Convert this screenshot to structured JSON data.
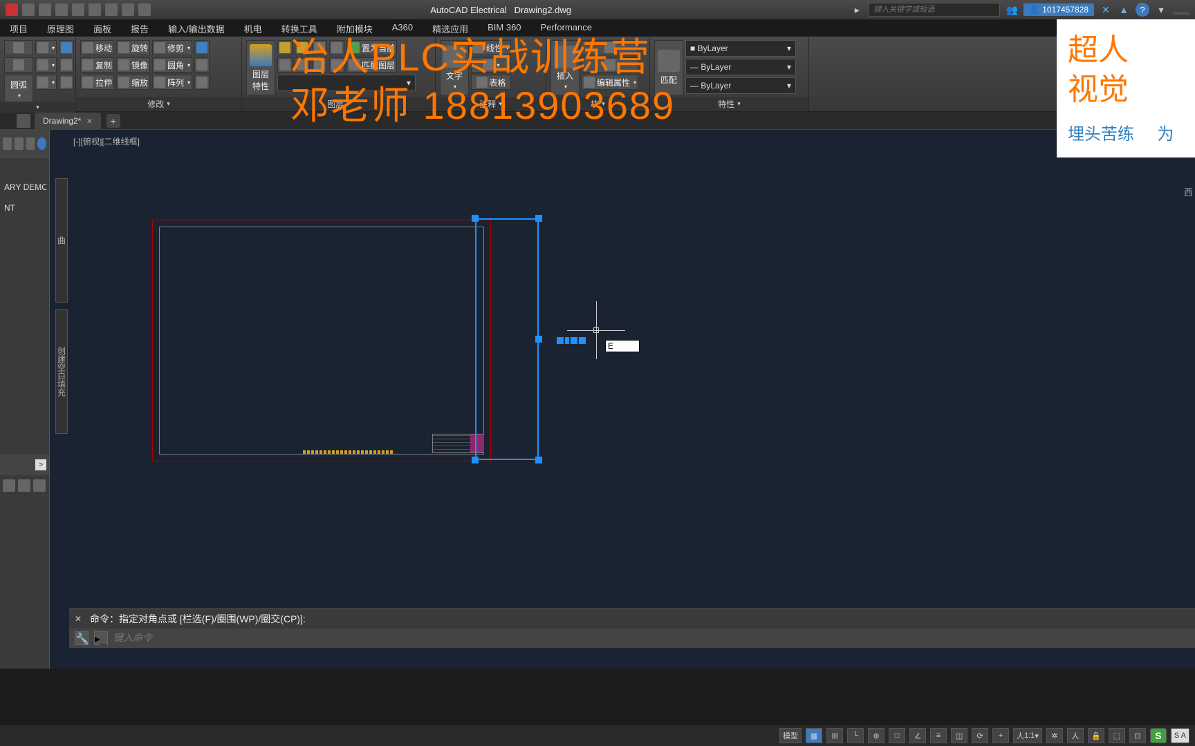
{
  "titlebar": {
    "app_name": "AutoCAD Electrical",
    "document": "Drawing2.dwg",
    "search_placeholder": "键入关键字或短语",
    "user_id": "1017457828",
    "help": "?"
  },
  "ribbon_tabs": [
    "项目",
    "原理图",
    "面板",
    "报告",
    "输入/输出数据",
    "机电",
    "转换工具",
    "附加模块",
    "A360",
    "精选应用",
    "BIM 360",
    "Performance"
  ],
  "ribbon": {
    "draw_panel": "圆弧",
    "modify": {
      "move": "移动",
      "rotate": "旋转",
      "trim": "修剪",
      "copy": "复制",
      "mirror": "镜像",
      "fillet": "圆角",
      "stretch": "拉伸",
      "scale": "缩放",
      "array": "阵列",
      "label": "修改"
    },
    "layers": {
      "big_btn": "图层\n特性",
      "match_layer": "匹配图层",
      "current": "置为当前",
      "label": "图层"
    },
    "annotation": {
      "text": "文字",
      "linetype": "线性",
      "table": "表格",
      "label": "注释"
    },
    "block": {
      "insert": "插入",
      "edit_attr": "编辑属性",
      "label": "块"
    },
    "properties": {
      "match": "匹配",
      "bylayer1": "ByLayer",
      "bylayer2": "ByLayer",
      "bylayer3": "ByLayer",
      "label": "特性"
    }
  },
  "doc_tab": {
    "name": "Drawing2*",
    "close": "×",
    "add": "+"
  },
  "sidebar": {
    "items": [
      "ARY DEMO",
      "",
      "NT"
    ],
    "arrow": ">"
  },
  "viewport": {
    "label": "[-][俯视][二维线框]",
    "panel1": "曲",
    "panel2": "创建空白填充",
    "right": "西"
  },
  "dynamic_input": "E",
  "command": {
    "history": "命令：指定对角点或 [栏选(F)/圈围(WP)/圈交(CP)]:",
    "placeholder": "键入命令"
  },
  "statusbar": {
    "model": "模型",
    "ratio": "1:1",
    "sa": "S A"
  },
  "watermark": {
    "line1": "冶人PLC实战训练营",
    "line2": "邓老师 18813903689",
    "box_line1": "超人",
    "box_line2": "视觉",
    "box_sub": "埋头苦练",
    "box_sub2": "为"
  }
}
